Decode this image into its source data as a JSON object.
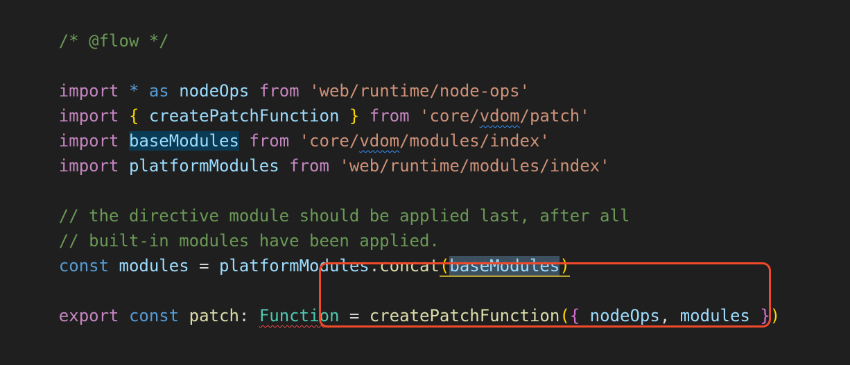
{
  "code": {
    "lines": [
      {
        "tokens": [
          {
            "t": "/* @flow */"
          }
        ]
      },
      {
        "tokens": []
      },
      {
        "tokens": [
          {
            "t": "import"
          },
          {
            "t": " "
          },
          {
            "t": "*"
          },
          {
            "t": " "
          },
          {
            "t": "as"
          },
          {
            "t": " "
          },
          {
            "t": "nodeOps"
          },
          {
            "t": " "
          },
          {
            "t": "from"
          },
          {
            "t": " "
          },
          {
            "t": "'web/runtime/node-ops'"
          }
        ]
      },
      {
        "tokens": [
          {
            "t": "import"
          },
          {
            "t": " "
          },
          {
            "t": "{"
          },
          {
            "t": " "
          },
          {
            "t": "createPatchFunction"
          },
          {
            "t": " "
          },
          {
            "t": "}"
          },
          {
            "t": " "
          },
          {
            "t": "from"
          },
          {
            "t": " "
          },
          {
            "t": "'core/"
          },
          {
            "t": "vdom"
          },
          {
            "t": "/patch'"
          }
        ]
      },
      {
        "tokens": [
          {
            "t": "import"
          },
          {
            "t": " "
          },
          {
            "t": "baseModules"
          },
          {
            "t": " "
          },
          {
            "t": "from"
          },
          {
            "t": " "
          },
          {
            "t": "'core/"
          },
          {
            "t": "vdom"
          },
          {
            "t": "/modules/index'"
          }
        ]
      },
      {
        "tokens": [
          {
            "t": "import"
          },
          {
            "t": " "
          },
          {
            "t": "platformModules"
          },
          {
            "t": " "
          },
          {
            "t": "from"
          },
          {
            "t": " "
          },
          {
            "t": "'web/runtime/modules/index'"
          }
        ]
      },
      {
        "tokens": []
      },
      {
        "tokens": [
          {
            "t": "// the directive module should be applied last, after all"
          }
        ]
      },
      {
        "tokens": [
          {
            "t": "// built-in modules have been applied."
          }
        ]
      },
      {
        "tokens": [
          {
            "t": "const"
          },
          {
            "t": " "
          },
          {
            "t": "modules"
          },
          {
            "t": " "
          },
          {
            "t": "="
          },
          {
            "t": " "
          },
          {
            "t": "platformModules"
          },
          {
            "t": "."
          },
          {
            "t": "concat"
          },
          {
            "t": "("
          },
          {
            "t": "baseModules"
          },
          {
            "t": ")"
          }
        ]
      },
      {
        "tokens": []
      },
      {
        "tokens": [
          {
            "t": "export"
          },
          {
            "t": " "
          },
          {
            "t": "const"
          },
          {
            "t": " "
          },
          {
            "t": "patch"
          },
          {
            "t": ":"
          },
          {
            "t": " "
          },
          {
            "t": "Function"
          },
          {
            "t": " "
          },
          {
            "t": "="
          },
          {
            "t": " "
          },
          {
            "t": "createPatchFunction"
          },
          {
            "t": "("
          },
          {
            "t": "{"
          },
          {
            "t": " "
          },
          {
            "t": "nodeOps"
          },
          {
            "t": ","
          },
          {
            "t": " "
          },
          {
            "t": "modules"
          },
          {
            "t": " "
          },
          {
            "t": "}"
          },
          {
            "t": ")"
          }
        ]
      }
    ]
  },
  "colors": {
    "background": "#1f1f1f",
    "comment": "#6a9955",
    "keyword": "#c586c0",
    "storage": "#569cd6",
    "identifier": "#9cdcfe",
    "function": "#dcdcaa",
    "type": "#4ec9b0",
    "string": "#ce9178",
    "annotation_box": "#f04a2a",
    "error_squiggle": "#f14c4c",
    "warning_squiggle": "#3794ff"
  }
}
